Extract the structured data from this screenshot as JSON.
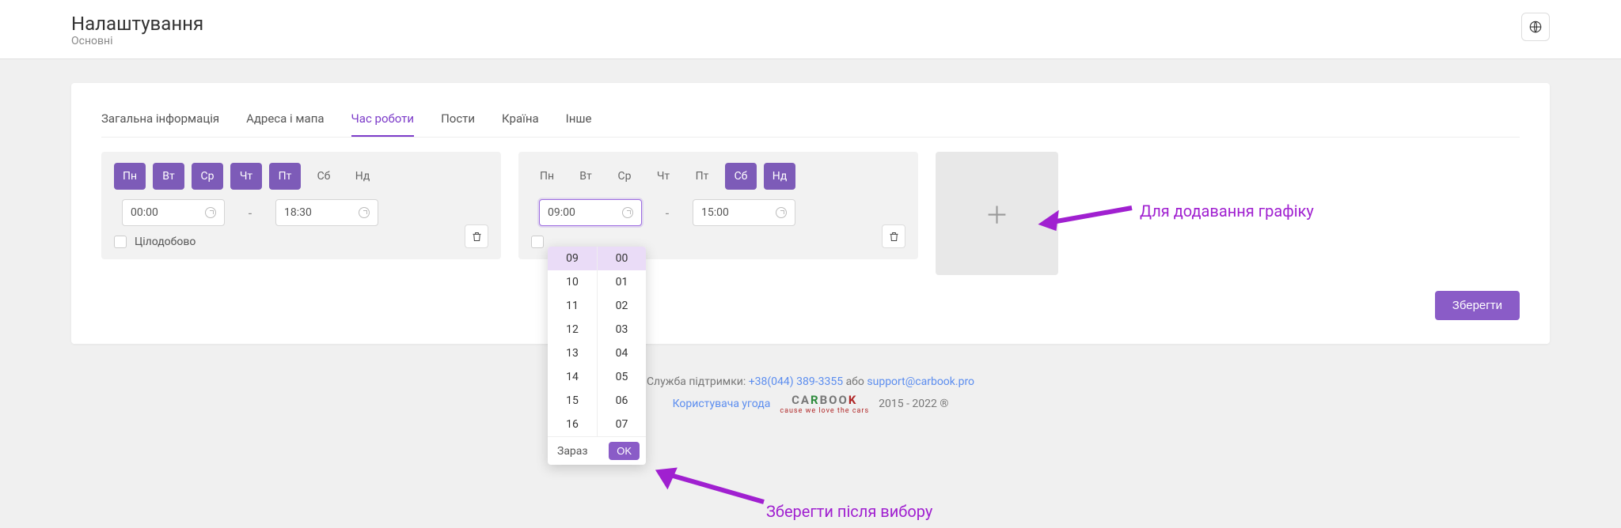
{
  "header": {
    "title": "Налаштування",
    "subtitle": "Основні"
  },
  "tabs": [
    {
      "label": "Загальна інформація",
      "active": false
    },
    {
      "label": "Адреса і мапа",
      "active": false
    },
    {
      "label": "Час роботи",
      "active": true
    },
    {
      "label": "Пости",
      "active": false
    },
    {
      "label": "Країна",
      "active": false
    },
    {
      "label": "Інше",
      "active": false
    }
  ],
  "days_labels": [
    "Пн",
    "Вт",
    "Ср",
    "Чт",
    "Пт",
    "Сб",
    "Нд"
  ],
  "card1": {
    "days_on": [
      true,
      true,
      true,
      true,
      true,
      false,
      false
    ],
    "from": "00:00",
    "to": "18:30",
    "allday_label": "Цілодобово"
  },
  "card2": {
    "days_on": [
      false,
      false,
      false,
      false,
      false,
      true,
      true
    ],
    "from": "09:00",
    "to": "15:00"
  },
  "dropdown": {
    "hours": [
      "09",
      "10",
      "11",
      "12",
      "13",
      "14",
      "15",
      "16"
    ],
    "mins": [
      "00",
      "01",
      "02",
      "03",
      "04",
      "05",
      "06",
      "07"
    ],
    "sel_hour": "09",
    "sel_min": "00",
    "now_label": "Зараз",
    "ok_label": "OK"
  },
  "save_label": "Зберегти",
  "annotations": {
    "add": "Для додавання  графіку",
    "ok": "Зберегти після вибору"
  },
  "footer": {
    "support_prefix": "Служба підтримки: ",
    "phone": "+38(044) 389-3355",
    "or": " або ",
    "email": "support@carbook.pro",
    "agreement": "Користувача угода",
    "years": "2015 - 2022 ®",
    "brand_car": "CA",
    "brand_r": "R",
    "brand_boo": "BOO",
    "brand_k": "K",
    "brand_tag": "cause we love the cars"
  }
}
